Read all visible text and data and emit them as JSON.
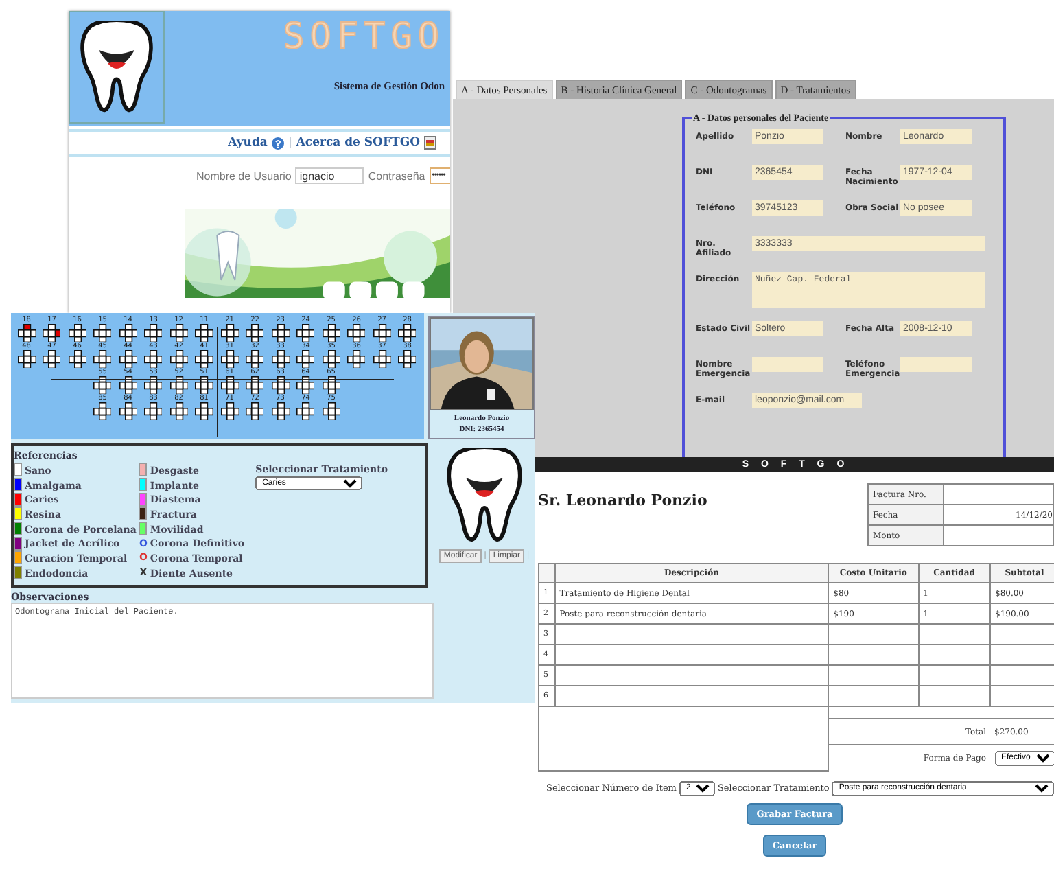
{
  "login_window": {
    "title": "SOFTGO",
    "subtitle": "Sistema de Gestión Odon",
    "links": [
      {
        "label": "Ayuda",
        "kind": "help"
      },
      {
        "label": "Acerca de SOFTGO",
        "kind": "about"
      }
    ],
    "link_separator": "|",
    "username_label": "Nombre de Usuario",
    "username": "ignacio",
    "password_label": "Contraseña",
    "password": "••••••"
  },
  "patient_window": {
    "tabs": [
      {
        "label": "A - Datos Personales",
        "selected": true
      },
      {
        "label": "B - Historia Clínica General",
        "selected": false
      },
      {
        "label": "C - Odontogramas",
        "selected": false
      },
      {
        "label": "D - Tratamientos",
        "selected": false
      }
    ],
    "legend": "A - Datos personales del Paciente",
    "rows": [
      [
        {
          "label": "Apellido",
          "value": "Ponzio",
          "kind": "input"
        },
        {
          "label": "Nombre",
          "value": "Leonardo",
          "kind": "input"
        }
      ],
      [
        {
          "label": "DNI",
          "value": "2365454",
          "kind": "input"
        },
        {
          "label": "Fecha Nacimiento",
          "value": "1977-12-04",
          "kind": "input"
        }
      ],
      [
        {
          "label": "Teléfono",
          "value": "39745123",
          "kind": "input"
        },
        {
          "label": "Obra Social",
          "value": "No posee",
          "kind": "input"
        }
      ],
      [
        {
          "label": "Nro. Afiliado",
          "value": "3333333",
          "kind": "wide"
        }
      ],
      [
        {
          "label": "Dirección",
          "value": "Nuñez Cap. Federal",
          "kind": "textarea"
        }
      ],
      [
        {
          "label": "Estado Civil",
          "value": "Soltero",
          "kind": "input"
        },
        {
          "label": "Fecha Alta",
          "value": "2008-12-10",
          "kind": "input"
        }
      ],
      [
        {
          "label": "Nombre Emergencia",
          "kind": "input"
        },
        {
          "label": "Teléfono Emergencia",
          "kind": "input"
        }
      ],
      [
        {
          "label": "E-mail",
          "value": "leoponzio@mail.com",
          "kind": "input"
        }
      ]
    ]
  },
  "odontogram_window": {
    "rows": [
      {
        "teeth": [
          {
            "number": "18",
            "marks": [
              {
                "kind": "top",
                "color": "#dd0000"
              }
            ]
          },
          {
            "number": "17",
            "marks": [
              {
                "kind": "right",
                "color": "#dd0000"
              }
            ]
          },
          {
            "number": "16"
          },
          {
            "number": "15"
          },
          {
            "number": "14"
          },
          {
            "number": "13"
          },
          {
            "number": "12"
          },
          {
            "number": "11"
          },
          {
            "number": "21"
          },
          {
            "number": "22"
          },
          {
            "number": "23"
          },
          {
            "number": "24"
          },
          {
            "number": "25"
          },
          {
            "number": "26"
          },
          {
            "number": "27"
          },
          {
            "number": "28"
          }
        ]
      },
      {
        "teeth": [
          {
            "number": "48"
          },
          {
            "number": "47"
          },
          {
            "number": "46"
          },
          {
            "number": "45"
          },
          {
            "number": "44"
          },
          {
            "number": "43"
          },
          {
            "number": "42"
          },
          {
            "number": "41"
          },
          {
            "number": "31"
          },
          {
            "number": "32"
          },
          {
            "number": "33"
          },
          {
            "number": "34"
          },
          {
            "number": "35"
          },
          {
            "number": "36"
          },
          {
            "number": "37"
          },
          {
            "number": "38"
          }
        ]
      },
      {
        "teeth": [
          {
            "number": "55"
          },
          {
            "number": "54"
          },
          {
            "number": "53"
          },
          {
            "number": "52"
          },
          {
            "number": "51"
          },
          {
            "number": "61"
          },
          {
            "number": "62"
          },
          {
            "number": "63"
          },
          {
            "number": "64"
          },
          {
            "number": "65"
          }
        ]
      },
      {
        "teeth": [
          {
            "number": "85"
          },
          {
            "number": "84"
          },
          {
            "number": "83"
          },
          {
            "number": "82"
          },
          {
            "number": "81"
          },
          {
            "number": "71"
          },
          {
            "number": "72"
          },
          {
            "number": "73"
          },
          {
            "number": "74"
          },
          {
            "number": "75"
          }
        ]
      }
    ],
    "patient_card": {
      "name": "Leonardo Ponzio",
      "dni": "DNI: 2365454"
    },
    "references_title": "Referencias",
    "references": [
      [
        {
          "label": "Sano",
          "kind": "swatch",
          "color": "#ffffff"
        },
        {
          "label": "Amalgama",
          "kind": "swatch",
          "color": "#0000ff"
        },
        {
          "label": "Caries",
          "kind": "swatch",
          "color": "#ff0000"
        },
        {
          "label": "Resina",
          "kind": "swatch",
          "color": "#ffff00"
        },
        {
          "label": "Corona de Porcelana",
          "kind": "swatch",
          "color": "#008000"
        },
        {
          "label": "Jacket de Acrílico",
          "kind": "swatch",
          "color": "#800080"
        },
        {
          "label": "Curacion Temporal",
          "kind": "swatch",
          "color": "#ffa500"
        },
        {
          "label": "Endodoncia",
          "kind": "swatch",
          "color": "#808000"
        }
      ],
      [
        {
          "label": "Desgaste",
          "kind": "swatch",
          "color": "#f4b0b0"
        },
        {
          "label": "Implante",
          "kind": "swatch",
          "color": "#00ffff"
        },
        {
          "label": "Diastema",
          "kind": "swatch",
          "color": "#ff44ff"
        },
        {
          "label": "Fractura",
          "kind": "swatch",
          "color": "#3b2314"
        },
        {
          "label": "Movilidad",
          "kind": "swatch",
          "color": "#66ff66"
        },
        {
          "label": "Corona Definitivo",
          "kind": "symbol",
          "symbol": "O",
          "color": "#3355dd"
        },
        {
          "label": "Corona Temporal",
          "kind": "symbol",
          "symbol": "O",
          "color": "#dd3333"
        },
        {
          "label": "Diente Ausente",
          "kind": "symbol",
          "symbol": "X",
          "color": "#333333"
        }
      ]
    ],
    "treatment_label": "Seleccionar Tratamiento",
    "treatment": "Caries",
    "buttons": [
      "Modificar",
      "Limpiar"
    ],
    "button_separator": "|",
    "observations_label": "Observaciones",
    "observations": "Odontograma Inicial del Paciente."
  },
  "invoice_window": {
    "brand": "S O F T G O",
    "patient": "Sr. Leonardo Ponzio",
    "info": [
      {
        "label": "Factura Nro."
      },
      {
        "label": "Fecha",
        "value": "14/12/20"
      },
      {
        "label": "Monto"
      }
    ],
    "columns": [
      "Descripción",
      "Costo Unitario",
      "Cantidad",
      "Subtotal"
    ],
    "rows": [
      {
        "number": "1",
        "cells": [
          "Tratamiento de Higiene Dental",
          "$80",
          "1",
          "$80.00"
        ]
      },
      {
        "number": "2",
        "cells": [
          "Poste para reconstrucción dentaria",
          "$190",
          "1",
          "$190.00"
        ]
      },
      {
        "number": "3",
        "cells": []
      },
      {
        "number": "4",
        "cells": []
      },
      {
        "number": "5",
        "cells": []
      },
      {
        "number": "6",
        "cells": []
      }
    ],
    "total_label": "Total",
    "total": "$270.00",
    "payment_label": "Forma de Pago",
    "payment": "Efectivo",
    "item_label": "Seleccionar Número de Item",
    "item": "2",
    "treatment_label": "Seleccionar Tratamiento",
    "treatment": "Poste para reconstrucción dentaria",
    "buttons": [
      "Grabar Factura",
      "Cancelar"
    ]
  }
}
